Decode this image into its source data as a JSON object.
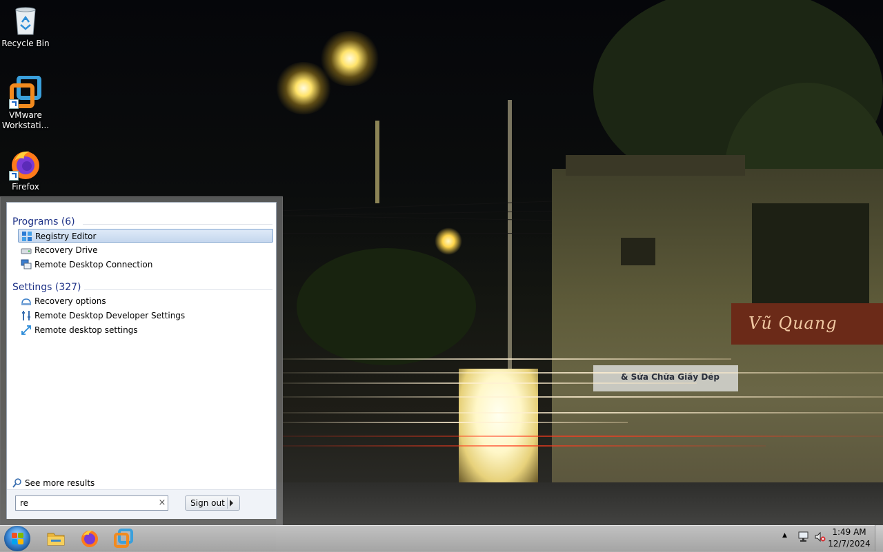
{
  "desktop": {
    "icons": [
      {
        "label": "Recycle Bin",
        "icon": "recycle-bin-icon"
      },
      {
        "label": "VMware Workstati...",
        "icon": "vmware-icon"
      },
      {
        "label": "Firefox",
        "icon": "firefox-icon"
      }
    ],
    "wallpaper": {
      "sign_text": "Vũ Quang",
      "banner_text": "& Sửa Chữa Giầy Dép"
    }
  },
  "start_menu": {
    "programs": {
      "heading": "Programs (6)",
      "items": [
        {
          "label": "Registry Editor",
          "icon": "registry-editor-icon",
          "selected": true
        },
        {
          "label": "Recovery Drive",
          "icon": "recovery-drive-icon",
          "selected": false
        },
        {
          "label": "Remote Desktop Connection",
          "icon": "remote-desktop-connection-icon",
          "selected": false
        }
      ]
    },
    "settings": {
      "heading": "Settings (327)",
      "items": [
        {
          "label": "Recovery options",
          "icon": "recovery-options-icon"
        },
        {
          "label": "Remote Desktop Developer Settings",
          "icon": "developer-settings-icon"
        },
        {
          "label": "Remote desktop settings",
          "icon": "remote-desktop-settings-icon"
        }
      ]
    },
    "see_more": "See more results",
    "search": {
      "value": "re",
      "clear": "×"
    },
    "signout_label": "Sign out"
  },
  "taskbar": {
    "pinned": [
      "file-explorer-icon",
      "firefox-icon",
      "vmware-icon"
    ],
    "tray": {
      "overflow": "▲",
      "network": "network-icon",
      "volume": "volume-muted-icon"
    },
    "clock": {
      "time": "1:49 AM",
      "date": "12/7/2024"
    }
  }
}
